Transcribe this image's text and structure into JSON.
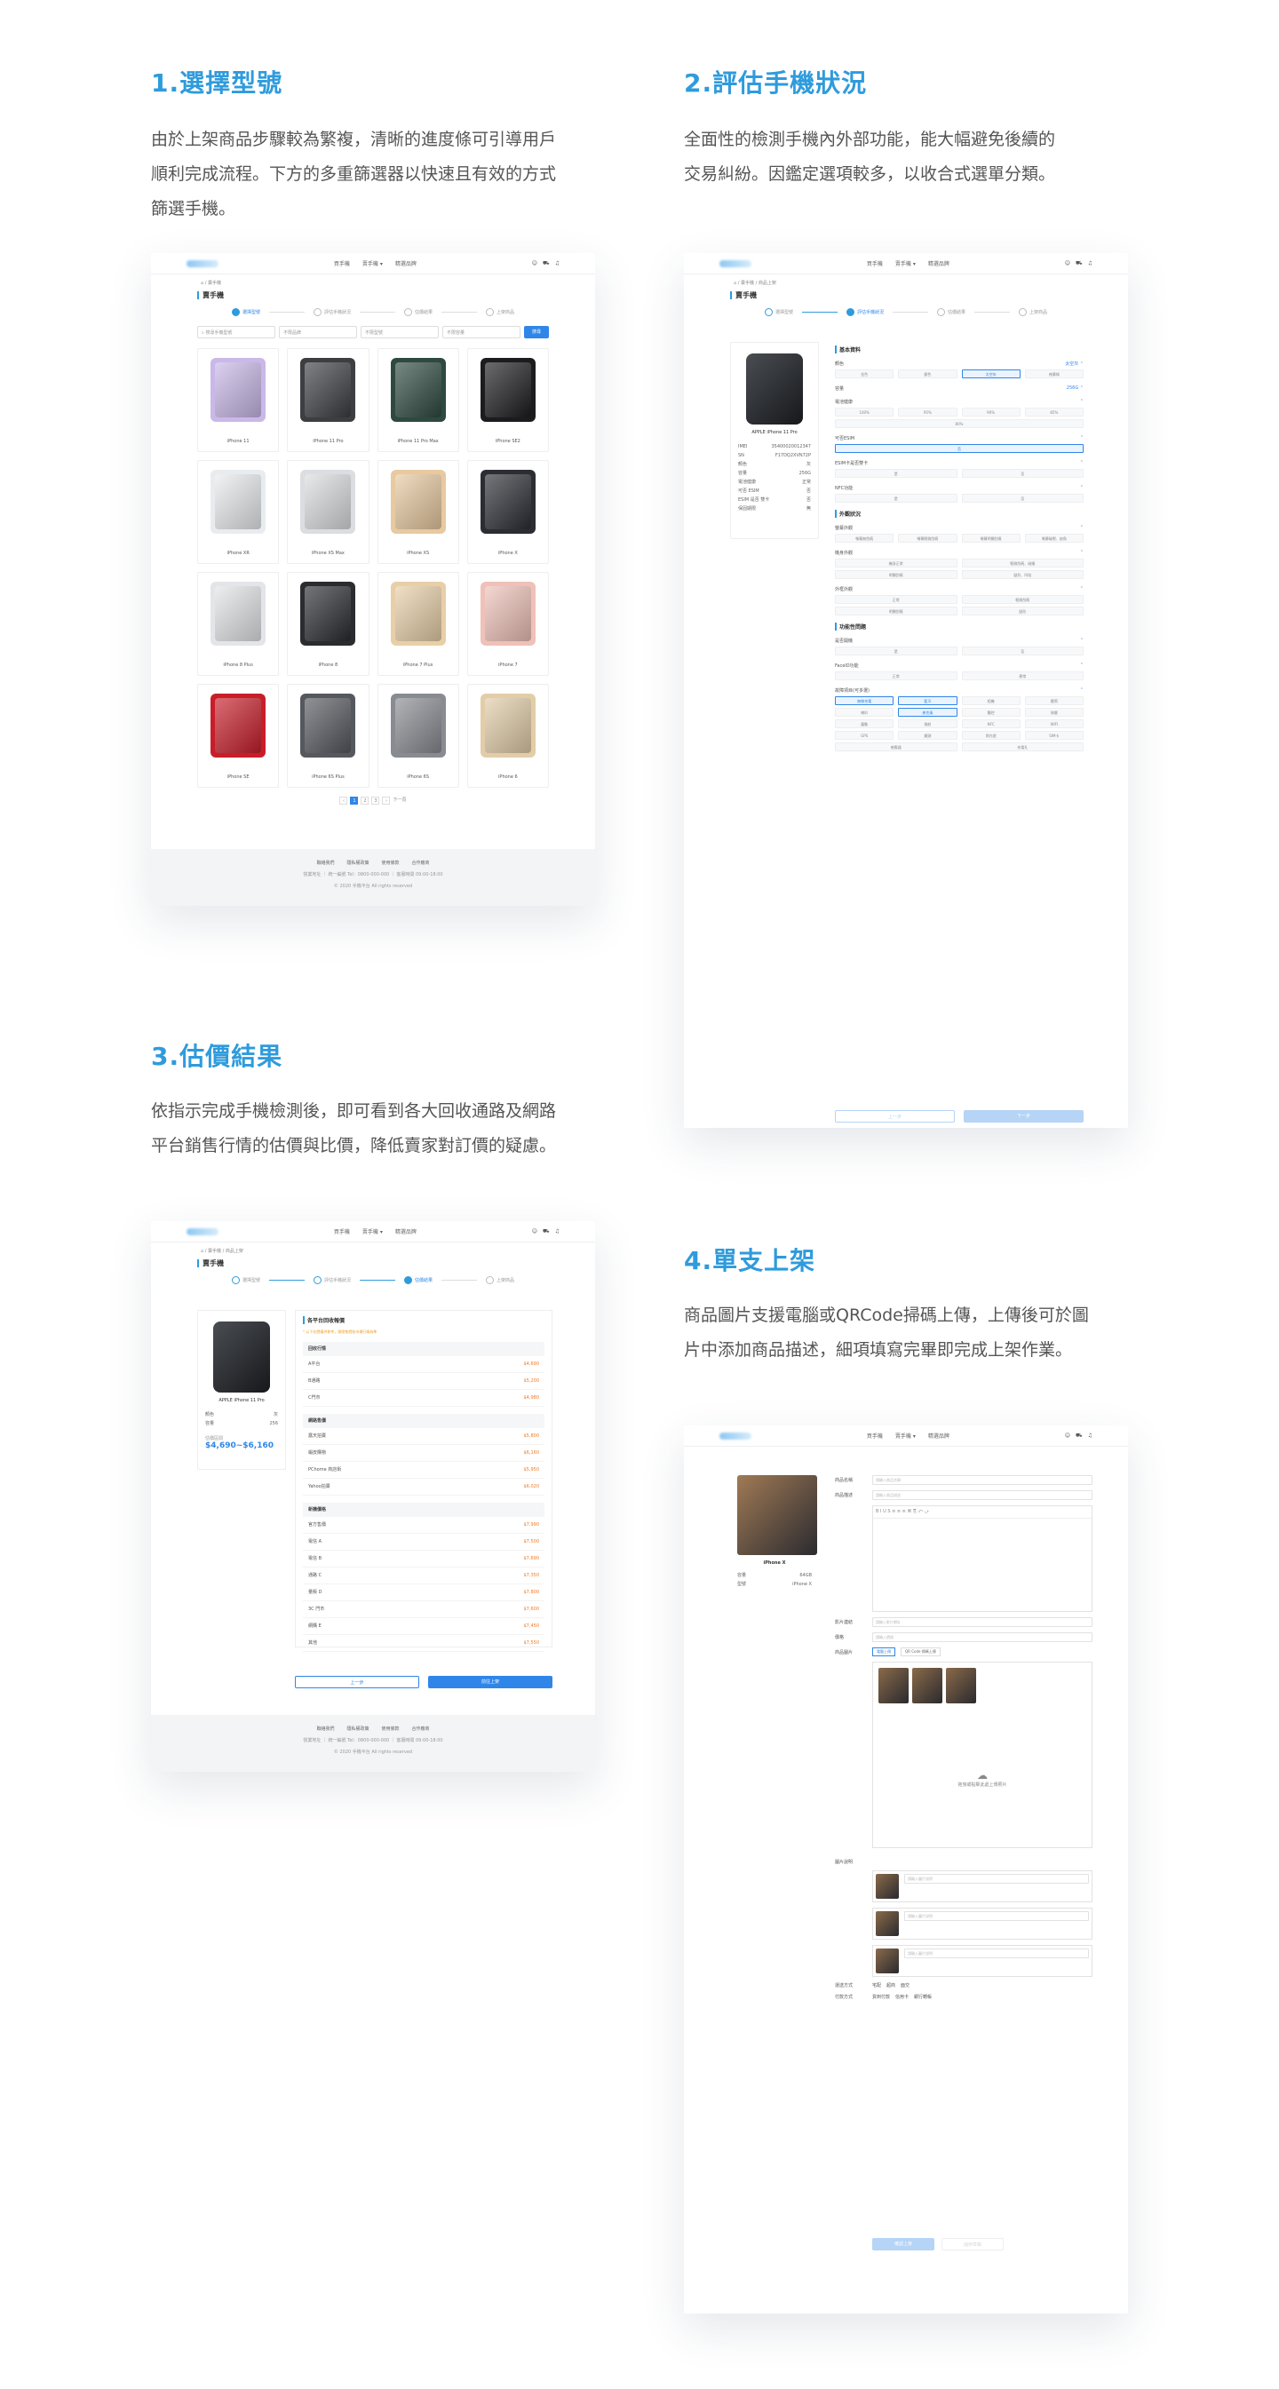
{
  "sections": [
    {
      "title": "1.選擇型號",
      "desc": [
        "由於上架商品步驟較為繁複，清晰的進度條可引導用戶",
        "順利完成流程。下方的多重篩選器以快速且有效的方式",
        "篩選手機。"
      ]
    },
    {
      "title": "2.評估手機狀況",
      "desc": [
        "全面性的檢測手機內外部功能，能大幅避免後續的",
        "交易糾紛。因鑑定選項較多，以收合式選單分類。"
      ]
    },
    {
      "title": "3.估價結果",
      "desc": [
        "依指示完成手機檢測後，即可看到各大回收通路及網路",
        "平台銷售行情的估價與比價，降低賣家對訂價的疑慮。"
      ]
    },
    {
      "title": "4.單支上架",
      "desc": [
        "商品圖片支援電腦或QRCode掃碼上傳，上傳後可於圖",
        "片中添加商品描述，細項填寫完畢即完成上架作業。"
      ]
    }
  ],
  "nav": {
    "items": [
      "買手機",
      "賣手機 ▾",
      "精選品牌"
    ],
    "icons": [
      "user-icon",
      "cart-icon",
      "bell-icon"
    ]
  },
  "common": {
    "crumb": "⌂ / 賣手機",
    "crumb2": "⌂ / 賣手機 / 商品上架",
    "page_title": "賣手機"
  },
  "steps": [
    "選擇型號",
    "評估手機狀況",
    "估價結果",
    "上架商品"
  ],
  "shot1": {
    "search_placeholder": "搜尋手機型號",
    "filters": [
      "不限品牌",
      "不限型號",
      "不限容量"
    ],
    "search_btn": "搜尋",
    "phones": [
      {
        "name": "iPhone 11",
        "color": "#c9b8e8"
      },
      {
        "name": "iPhone 11 Pro",
        "color": "#3c3e42"
      },
      {
        "name": "iPhone 11 Pro Max",
        "color": "#2e4a40"
      },
      {
        "name": "iPhone SE2",
        "color": "#1c1c1e"
      },
      {
        "name": "iPhone XR",
        "color": "#e9ecef"
      },
      {
        "name": "iPhone XS Max",
        "color": "#dcdde0"
      },
      {
        "name": "iPhone XS",
        "color": "#e8c9a0"
      },
      {
        "name": "iPhone X",
        "color": "#2b2d33"
      },
      {
        "name": "iPhone 8 Plus",
        "color": "#e3e5e8"
      },
      {
        "name": "iPhone 8",
        "color": "#2a2c30"
      },
      {
        "name": "iPhone 7 Plus",
        "color": "#e8cfa8"
      },
      {
        "name": "iPhone 7",
        "color": "#efc1b8"
      },
      {
        "name": "iPhone SE",
        "color": "#c81e2a"
      },
      {
        "name": "iPhone 6S Plus",
        "color": "#55585e"
      },
      {
        "name": "iPhone 6S",
        "color": "#888b91"
      },
      {
        "name": "iPhone 6",
        "color": "#e2cda8"
      }
    ],
    "pages": [
      "‹",
      "1",
      "2",
      "3",
      "›"
    ],
    "next_page": "下一頁"
  },
  "footer": {
    "links": [
      "聯絡我們",
      "隱私權政策",
      "使用條款",
      "合作廠商"
    ],
    "line": "營業地址 ｜ 統一編號 Tel：0800-000-000 ｜ 客服時間 09:00-18:00",
    "copy": "© 2020 手機平台 All rights reserved"
  },
  "shot2": {
    "model": "APPLE iPhone 11 Pro",
    "specs": [
      [
        "IMEI",
        "35400020012347"
      ],
      [
        "SN",
        "F17DQ2XVN72P"
      ],
      [
        "顏色",
        "灰"
      ],
      [
        "容量",
        "256G"
      ],
      [
        "電池健康",
        "正常"
      ],
      [
        "可否 ESIM",
        "否"
      ],
      [
        "ESIM 是否 雙卡",
        "否"
      ],
      [
        "保固期限",
        "無"
      ]
    ],
    "group1": "基本資料",
    "color_q": "顏色",
    "color_opts": [
      "金色",
      "銀色",
      "太空灰",
      "夜幕綠"
    ],
    "capacity_q": "容量",
    "capacity_val": "256G",
    "batt_q": "電池健康",
    "batt_opts": [
      "100%",
      "95%",
      "90%",
      "85%",
      "80%"
    ],
    "esim_q": "可否ESIM",
    "esim_opts": [
      "否"
    ],
    "dual_q": "ESIM卡是否雙卡",
    "dual_opts": [
      "是",
      "否"
    ],
    "nfc_q": "NFC功能",
    "nfc_opts": [
      "是",
      "否"
    ],
    "group2": "外觀狀況",
    "screen_q": "螢幕外觀",
    "screen_opts": [
      "螢幕無刮痕",
      "螢幕輕微刮痕",
      "螢幕明顯刮痕",
      "螢幕破裂、缺角"
    ],
    "body_q": "機身外觀",
    "body_opts": [
      "機身正常",
      "輕微刮痕、碰撞",
      "明顯刮痕",
      "變形、凹陷"
    ],
    "frame_q": "外框外觀",
    "frame_opts": [
      "正常",
      "輕微刮痕",
      "明顯刮痕",
      "變形"
    ],
    "group3": "功能性問題",
    "boot_q": "是否開機",
    "boot_opts": [
      "是",
      "否"
    ],
    "face_q": "FaceID功能",
    "face_opts": [
      "正常",
      "異常"
    ],
    "func_q": "故障項目(可多選)",
    "func_opts": [
      "無線充電",
      "藍牙",
      "相機",
      "聽筒",
      "喇叭",
      "麥克風",
      "觸控",
      "按鍵",
      "震動",
      "指紋",
      "NFC",
      "WIFI",
      "GPS",
      "鏡頭",
      "閃光燈",
      "SIM卡",
      "感應器",
      "充電孔"
    ],
    "btn_prev": "上一步",
    "btn_next": "下一步"
  },
  "shot3": {
    "model": "APPLE iPhone 11 Pro",
    "specs": [
      [
        "顏色",
        "灰"
      ],
      [
        "容量",
        "256"
      ]
    ],
    "est_label": "估價區間",
    "est_range": "$4,690~$6,160",
    "title": "各平台回收報價",
    "note": "* 以下估價僅供參考，實際售價依市場行情為準",
    "groups": [
      {
        "head": "回收行情",
        "rows": [
          [
            "A平台",
            "$4,690"
          ],
          [
            "B通路",
            "$5,200"
          ],
          [
            "C門市",
            "$4,980"
          ]
        ]
      },
      {
        "head": "網路售價",
        "rows": [
          [
            "露天拍賣",
            "$5,800"
          ],
          [
            "蝦皮購物",
            "$6,160"
          ],
          [
            "PChome 商店街",
            "$5,950"
          ],
          [
            "Yahoo拍賣",
            "$6,020"
          ]
        ]
      },
      {
        "head": "新機價格",
        "rows": [
          [
            "官方售價",
            "$7,990"
          ],
          [
            "電信 A",
            "$7,500"
          ],
          [
            "電信 B",
            "$7,690"
          ],
          [
            "通路 C",
            "$7,350"
          ],
          [
            "量販 D",
            "$7,800"
          ],
          [
            "3C 門市",
            "$7,600"
          ],
          [
            "網購 E",
            "$7,450"
          ],
          [
            "其他",
            "$7,550"
          ]
        ]
      }
    ],
    "btn_prev": "上一步",
    "btn_next": "前往上架"
  },
  "shot4": {
    "model": "iPhone X",
    "specs": [
      [
        "容量",
        "64GB"
      ],
      [
        "型號",
        "iPhone X"
      ]
    ],
    "title_lbl": "商品名稱",
    "title_ph": "請輸入商品名稱",
    "desc_lbl": "商品描述",
    "desc_ph": "請輸入商品描述",
    "video_lbl": "影片連結",
    "video_ph": "請輸入影片網址",
    "price_lbl": "價格",
    "price_ph": "請輸入價格",
    "photo_lbl": "商品圖片",
    "tabs": [
      "電腦上傳",
      "QR Code 掃碼上傳"
    ],
    "upload_hint": "拖曳或點擊此處上傳照片",
    "mark_lbl": "圖片說明",
    "mark_ph": "請輸入圖片說明",
    "ship_lbl": "運送方式",
    "ship_opts": [
      "宅配",
      "超商",
      "面交"
    ],
    "pay_lbl": "付款方式",
    "pay_opts": [
      "貨到付款",
      "信用卡",
      "銀行轉帳"
    ],
    "btn_submit": "確認上架",
    "btn_draft": "儲存草稿"
  }
}
